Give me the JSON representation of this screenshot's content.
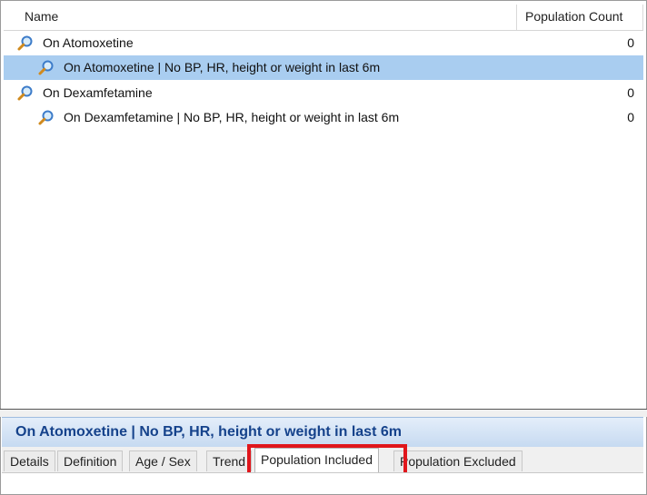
{
  "grid": {
    "columns": {
      "name": "Name",
      "count": "Population Count"
    },
    "rows": [
      {
        "label": "On Atomoxetine",
        "count": "0",
        "icon": "search-magnifier-icon"
      },
      {
        "label": "On Atomoxetine | No BP, HR, height or weight in last 6m",
        "count": "",
        "icon": "search-magnifier-icon",
        "selected": true
      },
      {
        "label": "On Dexamfetamine",
        "count": "0",
        "icon": "search-magnifier-icon"
      },
      {
        "label": "On Dexamfetamine | No BP, HR, height or weight in last 6m",
        "count": "0",
        "icon": "search-magnifier-icon"
      }
    ]
  },
  "detail": {
    "title": "On Atomoxetine | No BP, HR, height or weight in last 6m"
  },
  "tabs": [
    {
      "label": "Details"
    },
    {
      "label": "Definition"
    },
    {
      "label": "Age / Sex"
    },
    {
      "label": "Trend"
    },
    {
      "label": "Population Included",
      "active": true
    },
    {
      "label": "Population Excluded"
    }
  ],
  "colors": {
    "selection": "#a9cdf0",
    "title_text": "#15428b",
    "highlight": "#e0161c"
  }
}
